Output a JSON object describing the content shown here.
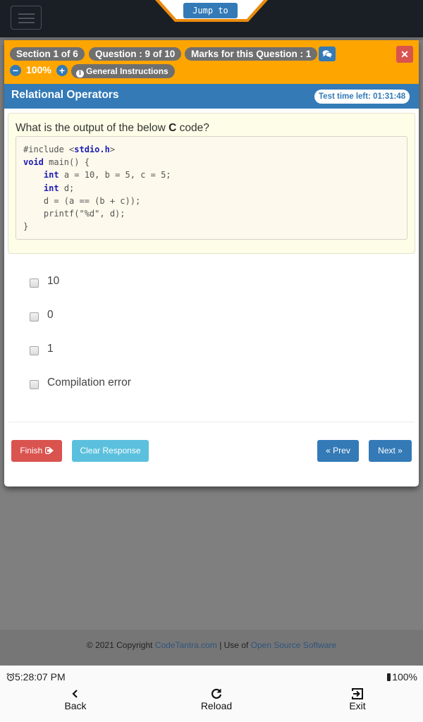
{
  "navbar": {
    "menu_icon": "hamburger-icon",
    "jump_to_label": "Jump to"
  },
  "header": {
    "section": "Section 1 of 6",
    "question": "Question : 9 of 10",
    "marks": "Marks for this Question : 1",
    "chat_icon": "comments-icon",
    "close_icon": "close-icon",
    "close_glyph": "✕",
    "zoom_out_glyph": "−",
    "zoom_in_glyph": "+",
    "zoom_level": "100%",
    "general_instructions": "General Instructions",
    "info_glyph": "i"
  },
  "titlebar": {
    "section_title": "Relational Operators",
    "timer": "Test time left: 01:31:48"
  },
  "question": {
    "prefix": "What is the output of the below ",
    "language": "C",
    "suffix": " code?",
    "code_lines": [
      {
        "parts": [
          {
            "t": "#include <",
            "k": false
          },
          {
            "t": "stdio.h",
            "k": true
          },
          {
            "t": ">",
            "k": false
          }
        ]
      },
      {
        "parts": [
          {
            "t": "void",
            "k": true
          },
          {
            "t": " main() {",
            "k": false
          }
        ]
      },
      {
        "parts": [
          {
            "t": "    ",
            "k": false
          },
          {
            "t": "int",
            "k": true
          },
          {
            "t": " a = 10, b = 5, c = 5;",
            "k": false
          }
        ]
      },
      {
        "parts": [
          {
            "t": "    ",
            "k": false
          },
          {
            "t": "int",
            "k": true
          },
          {
            "t": " d;",
            "k": false
          }
        ]
      },
      {
        "parts": [
          {
            "t": "    d = (a == (b + c));",
            "k": false
          }
        ]
      },
      {
        "parts": [
          {
            "t": "    printf(\"%d\", d);",
            "k": false
          }
        ]
      },
      {
        "parts": [
          {
            "t": "}",
            "k": false
          }
        ]
      }
    ]
  },
  "options": [
    {
      "label": "10",
      "checked": false
    },
    {
      "label": "0",
      "checked": false
    },
    {
      "label": "1",
      "checked": false
    },
    {
      "label": "Compilation error",
      "checked": false
    }
  ],
  "actions": {
    "finish": "Finish",
    "clear": "Clear Response",
    "prev": "« Prev",
    "next": "Next »"
  },
  "footer": {
    "copyright": "© 2021 Copyright ",
    "site_link": "CodeTantra.com",
    "separator": " | Use of ",
    "oss_link": "Open Source Software"
  },
  "appbar": {
    "clock": "5:28:07 PM",
    "battery": "100%",
    "back": "Back",
    "reload": "Reload",
    "exit": "Exit"
  },
  "colors": {
    "navbar": "#1a1f26",
    "header_orange": "#ffa500",
    "primary_blue": "#337ab7",
    "danger_red": "#d9534f",
    "info_cyan": "#5bc0de",
    "pill_gray": "#6f6f6f",
    "question_bg": "#fefee8"
  }
}
